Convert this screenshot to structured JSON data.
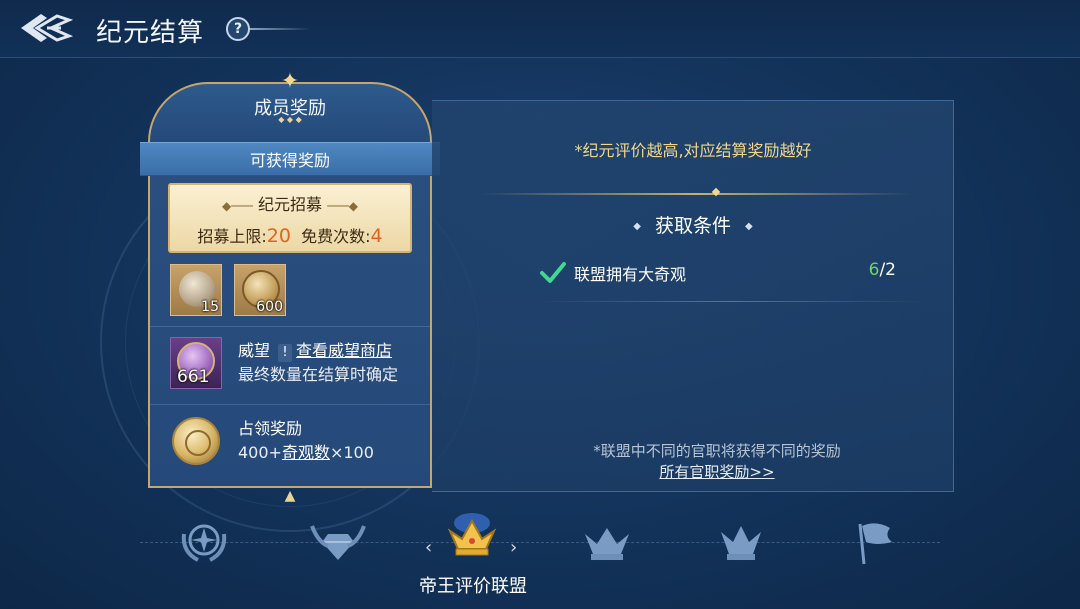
{
  "header": {
    "title": "纪元结算",
    "help_label": "?"
  },
  "member_card": {
    "title": "成员奖励",
    "ribbon_label": "可获得奖励",
    "recruit": {
      "title": "纪元招募",
      "limit_label": "招募上限:",
      "limit_value": "20",
      "free_label": "免费次数:",
      "free_value": "4"
    },
    "resources": [
      {
        "icon": "statue-bust-icon",
        "qty": "15"
      },
      {
        "icon": "gold-coin-icon",
        "qty": "600"
      }
    ],
    "prestige": {
      "icon": "prestige-medal-icon",
      "qty": "661",
      "title": "威望",
      "link": "查看威望商店",
      "note": "最终数量在结算时确定"
    },
    "occupy": {
      "icon": "occupy-coin-icon",
      "title": "占领奖励",
      "formula_prefix": "400+",
      "formula_link": "奇观数",
      "formula_suffix": "×100"
    }
  },
  "right_panel": {
    "eval_note": "*纪元评价越高,对应结算奖励越好",
    "condition_title": "获取条件",
    "condition": {
      "label": "联盟拥有大奇观",
      "current": "6",
      "total": "/2"
    },
    "office_note": "*联盟中不同的官职将获得不同的奖励",
    "office_link": "所有官职奖励>>"
  },
  "tiers": {
    "selected_label": "帝王评价联盟",
    "items": [
      "laurel-emblem-icon",
      "winged-diamond-icon",
      "gold-crown-icon",
      "silver-crown-icon",
      "blue-crown-icon",
      "flag-icon"
    ]
  },
  "colors": {
    "accent_gold": "#f0d78a",
    "highlight_orange": "#e0641c",
    "progress_green": "#6fd46a"
  }
}
